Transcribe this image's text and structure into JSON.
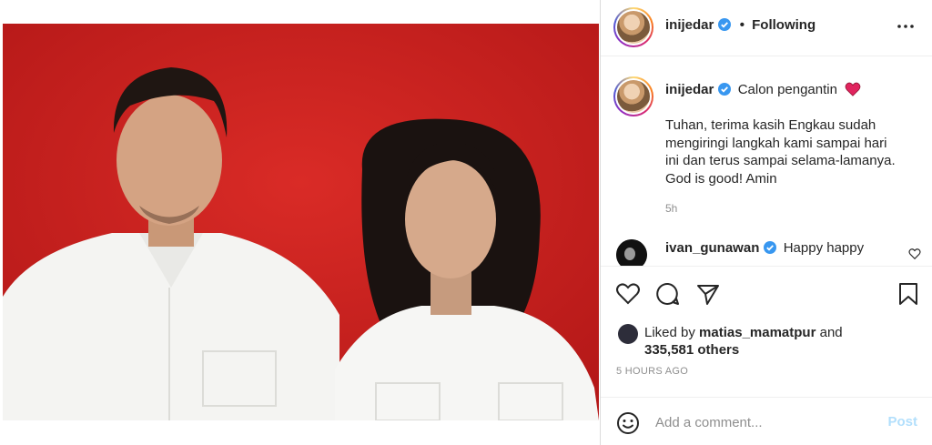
{
  "post": {
    "image_alt": "Man and woman in white shirts in front of red background",
    "colors": {
      "background_red": "#d01f1e",
      "verified_blue": "#3897f0",
      "post_button": "#b2dffc"
    }
  },
  "header": {
    "username": "inijedar",
    "separator": "•",
    "follow_status": "Following",
    "more_icon": "ellipsis-icon"
  },
  "caption": {
    "username": "inijedar",
    "title": "Calon pengantin",
    "emoji": "red-heart-icon",
    "body": "Tuhan, terima kasih Engkau sudah mengiringi langkah kami sampai hari ini dan terus sampai selama-lamanya. God is good! Amin",
    "time": "5h"
  },
  "comments": [
    {
      "username": "ivan_gunawan",
      "text": "Happy happy"
    }
  ],
  "actions": {
    "like_icon": "heart-icon",
    "comment_icon": "comment-icon",
    "share_icon": "paper-plane-icon",
    "save_icon": "bookmark-icon"
  },
  "likes": {
    "prefix": "Liked by",
    "user": "matias_mamatpur",
    "conjunction": "and",
    "others": "335,581 others"
  },
  "timestamp": "5 HOURS AGO",
  "add_comment": {
    "placeholder": "Add a comment...",
    "post_label": "Post"
  }
}
